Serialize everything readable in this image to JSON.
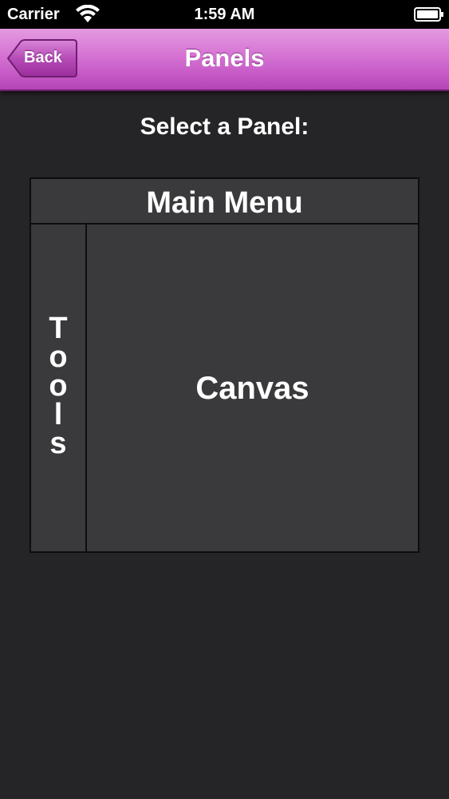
{
  "status_bar": {
    "carrier": "Carrier",
    "time": "1:59 AM",
    "wifi_icon": "wifi-icon",
    "battery_icon": "battery-icon"
  },
  "nav_bar": {
    "title": "Panels",
    "back_label": "Back",
    "accent_color": "#c659c6"
  },
  "content": {
    "prompt": "Select a Panel:",
    "panels": {
      "main_menu": "Main Menu",
      "tools": "T\no\no\nl\ns",
      "canvas": "Canvas"
    }
  },
  "colors": {
    "background": "#252426",
    "panel_fill": "#3a393b",
    "panel_border": "#0d0d0d"
  }
}
